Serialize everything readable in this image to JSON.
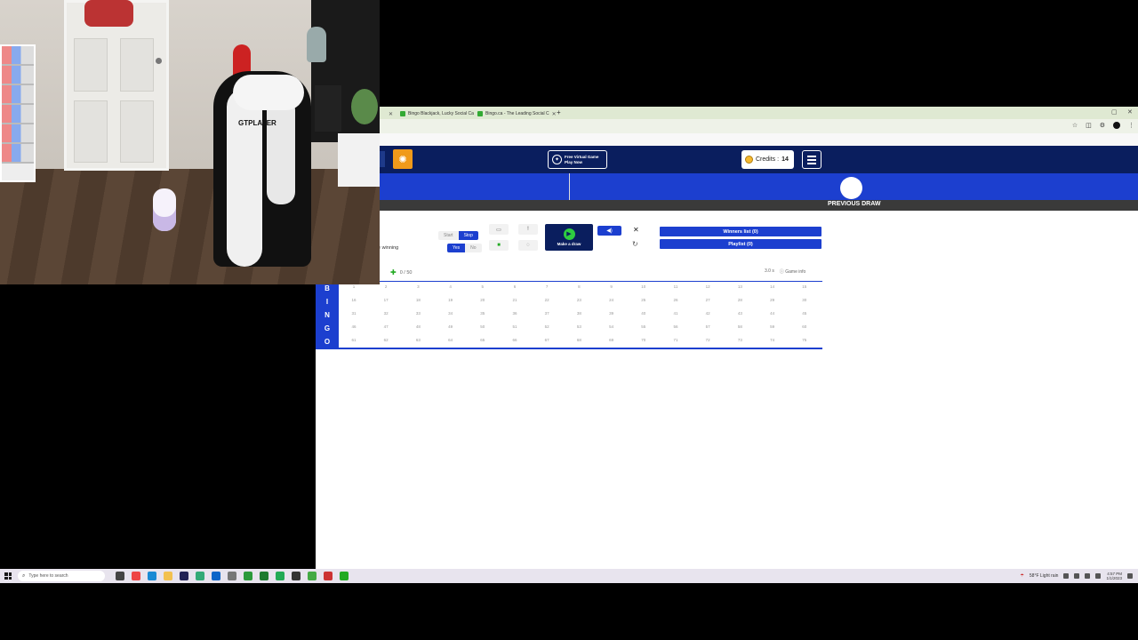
{
  "browser": {
    "tabs": [
      {
        "label": "Bingo Blackjack, Lucky Social Ca"
      },
      {
        "label": "Bingo.ca - The Leading Social C"
      }
    ],
    "new_tab": "+"
  },
  "navbar": {
    "free_game_line1": "Free Virtual Game",
    "free_game_line2": "Play Now",
    "credits_label": "Credits :",
    "credits_value": "14"
  },
  "draw": {
    "previous_draw_label": "PREVIOUS DRAW"
  },
  "controls": {
    "toggle1": {
      "off": "Start",
      "on": "Stop"
    },
    "toggle2": {
      "on": "Yes",
      "off": "No"
    },
    "winning_label": "e winning",
    "make_draw_label": "Make a draw",
    "winners_list_label": "Winners list (0)",
    "playlist_label": "Playlist (0)"
  },
  "card_header": {
    "count": "0 / 50",
    "speed": "3.0 s",
    "game_info": "Game info"
  },
  "board": {
    "rows": [
      {
        "letter": "B",
        "numbers": [
          "1",
          "2",
          "3",
          "4",
          "5",
          "6",
          "7",
          "8",
          "9",
          "10",
          "11",
          "12",
          "13",
          "14",
          "15"
        ]
      },
      {
        "letter": "I",
        "numbers": [
          "16",
          "17",
          "18",
          "19",
          "20",
          "21",
          "22",
          "23",
          "24",
          "25",
          "26",
          "27",
          "28",
          "29",
          "30"
        ]
      },
      {
        "letter": "N",
        "numbers": [
          "31",
          "32",
          "33",
          "34",
          "35",
          "36",
          "37",
          "38",
          "39",
          "40",
          "41",
          "42",
          "43",
          "44",
          "45"
        ]
      },
      {
        "letter": "G",
        "numbers": [
          "46",
          "47",
          "48",
          "49",
          "50",
          "51",
          "52",
          "53",
          "54",
          "55",
          "56",
          "57",
          "58",
          "59",
          "60"
        ]
      },
      {
        "letter": "O",
        "numbers": [
          "61",
          "62",
          "63",
          "64",
          "65",
          "66",
          "67",
          "68",
          "69",
          "70",
          "71",
          "72",
          "73",
          "74",
          "75"
        ]
      }
    ]
  },
  "taskbar": {
    "search_placeholder": "Type here to search",
    "weather": "58°F  Light rain",
    "time": "4:57 PM",
    "date": "1/1/2023"
  },
  "webcam": {
    "chair_brand": "GTPLAYER"
  },
  "colors": {
    "navy": "#0a1e5e",
    "blue": "#1c3fcf",
    "accent_orange": "#f09a1a",
    "play_green": "#2ecc40"
  }
}
